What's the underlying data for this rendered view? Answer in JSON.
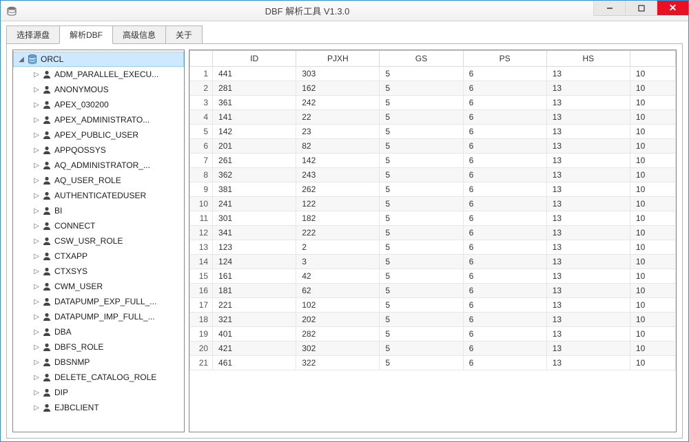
{
  "window": {
    "title": "DBF 解析工具  V1.3.0"
  },
  "tabs": [
    {
      "label": "选择源盘",
      "active": false
    },
    {
      "label": "解析DBF",
      "active": true
    },
    {
      "label": "高级信息",
      "active": false
    },
    {
      "label": "关于",
      "active": false
    }
  ],
  "tree": {
    "root": {
      "label": "ORCL",
      "selected": true
    },
    "children": [
      {
        "label": "ADM_PARALLEL_EXECU..."
      },
      {
        "label": "ANONYMOUS"
      },
      {
        "label": "APEX_030200"
      },
      {
        "label": "APEX_ADMINISTRATO..."
      },
      {
        "label": "APEX_PUBLIC_USER"
      },
      {
        "label": "APPQOSSYS"
      },
      {
        "label": "AQ_ADMINISTRATOR_..."
      },
      {
        "label": "AQ_USER_ROLE"
      },
      {
        "label": "AUTHENTICATEDUSER"
      },
      {
        "label": "BI"
      },
      {
        "label": "CONNECT"
      },
      {
        "label": "CSW_USR_ROLE"
      },
      {
        "label": "CTXAPP"
      },
      {
        "label": "CTXSYS"
      },
      {
        "label": "CWM_USER"
      },
      {
        "label": "DATAPUMP_EXP_FULL_..."
      },
      {
        "label": "DATAPUMP_IMP_FULL_..."
      },
      {
        "label": "DBA"
      },
      {
        "label": "DBFS_ROLE"
      },
      {
        "label": "DBSNMP"
      },
      {
        "label": "DELETE_CATALOG_ROLE"
      },
      {
        "label": "DIP"
      },
      {
        "label": "EJBCLIENT"
      }
    ]
  },
  "grid": {
    "columns": [
      "ID",
      "PJXH",
      "GS",
      "PS",
      "HS",
      ""
    ],
    "rows": [
      {
        "n": "1",
        "id": "441",
        "pjxh": "303",
        "gs": "5",
        "ps": "6",
        "hs": "13",
        "last": "10"
      },
      {
        "n": "2",
        "id": "281",
        "pjxh": "162",
        "gs": "5",
        "ps": "6",
        "hs": "13",
        "last": "10"
      },
      {
        "n": "3",
        "id": "361",
        "pjxh": "242",
        "gs": "5",
        "ps": "6",
        "hs": "13",
        "last": "10"
      },
      {
        "n": "4",
        "id": "141",
        "pjxh": "22",
        "gs": "5",
        "ps": "6",
        "hs": "13",
        "last": "10"
      },
      {
        "n": "5",
        "id": "142",
        "pjxh": "23",
        "gs": "5",
        "ps": "6",
        "hs": "13",
        "last": "10"
      },
      {
        "n": "6",
        "id": "201",
        "pjxh": "82",
        "gs": "5",
        "ps": "6",
        "hs": "13",
        "last": "10"
      },
      {
        "n": "7",
        "id": "261",
        "pjxh": "142",
        "gs": "5",
        "ps": "6",
        "hs": "13",
        "last": "10"
      },
      {
        "n": "8",
        "id": "362",
        "pjxh": "243",
        "gs": "5",
        "ps": "6",
        "hs": "13",
        "last": "10"
      },
      {
        "n": "9",
        "id": "381",
        "pjxh": "262",
        "gs": "5",
        "ps": "6",
        "hs": "13",
        "last": "10"
      },
      {
        "n": "10",
        "id": "241",
        "pjxh": "122",
        "gs": "5",
        "ps": "6",
        "hs": "13",
        "last": "10"
      },
      {
        "n": "11",
        "id": "301",
        "pjxh": "182",
        "gs": "5",
        "ps": "6",
        "hs": "13",
        "last": "10"
      },
      {
        "n": "12",
        "id": "341",
        "pjxh": "222",
        "gs": "5",
        "ps": "6",
        "hs": "13",
        "last": "10"
      },
      {
        "n": "13",
        "id": "123",
        "pjxh": "2",
        "gs": "5",
        "ps": "6",
        "hs": "13",
        "last": "10"
      },
      {
        "n": "14",
        "id": "124",
        "pjxh": "3",
        "gs": "5",
        "ps": "6",
        "hs": "13",
        "last": "10"
      },
      {
        "n": "15",
        "id": "161",
        "pjxh": "42",
        "gs": "5",
        "ps": "6",
        "hs": "13",
        "last": "10"
      },
      {
        "n": "16",
        "id": "181",
        "pjxh": "62",
        "gs": "5",
        "ps": "6",
        "hs": "13",
        "last": "10"
      },
      {
        "n": "17",
        "id": "221",
        "pjxh": "102",
        "gs": "5",
        "ps": "6",
        "hs": "13",
        "last": "10"
      },
      {
        "n": "18",
        "id": "321",
        "pjxh": "202",
        "gs": "5",
        "ps": "6",
        "hs": "13",
        "last": "10"
      },
      {
        "n": "19",
        "id": "401",
        "pjxh": "282",
        "gs": "5",
        "ps": "6",
        "hs": "13",
        "last": "10"
      },
      {
        "n": "20",
        "id": "421",
        "pjxh": "302",
        "gs": "5",
        "ps": "6",
        "hs": "13",
        "last": "10"
      },
      {
        "n": "21",
        "id": "461",
        "pjxh": "322",
        "gs": "5",
        "ps": "6",
        "hs": "13",
        "last": "10"
      }
    ]
  }
}
